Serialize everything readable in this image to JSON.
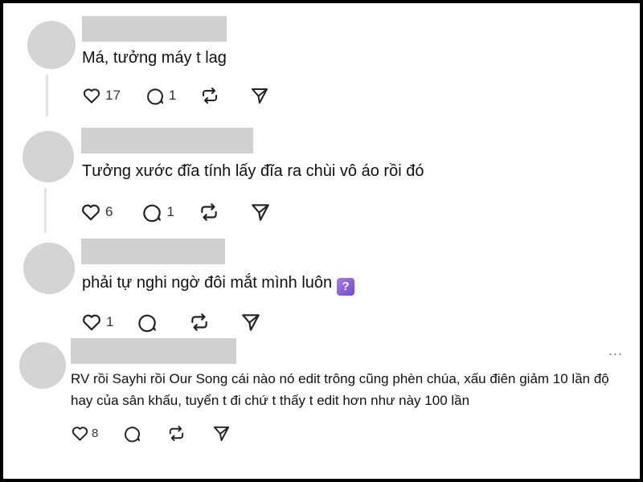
{
  "comments": [
    {
      "text": "Má, tưởng máy t lag",
      "likes": "17",
      "replies": "1"
    },
    {
      "text": "Tưởng xước đĩa tính lấy đĩa ra chùi vô áo rồi đó",
      "likes": "6",
      "replies": "1"
    },
    {
      "text": "phải tự nghi ngờ đôi mắt mình luôn",
      "emoji": "?",
      "likes": "1"
    },
    {
      "text": "RV rồi Sayhi rồi Our Song cái nào nó edit trông cũng phèn chúa, xấu điên giảm 10 lần độ hay của sân khấu, tuyển t đi chứ t thấy t edit hơn như này 100 lần",
      "likes": "8",
      "more": "..."
    }
  ],
  "icons": {
    "like": "heart-icon",
    "reply": "speech-bubble-icon",
    "repost": "repost-icon",
    "share": "send-icon",
    "more": "more-options-icon"
  },
  "colors": {
    "icon": "#222222",
    "avatar": "#d4d4d4",
    "thread_line": "#e2e2e2"
  }
}
